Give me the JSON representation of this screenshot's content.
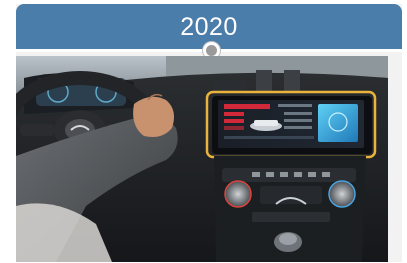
{
  "timeline": {
    "year": "2020"
  },
  "photo": {
    "highlight_color": "#e9b33c",
    "screen_accent": "#3fb6e8",
    "screen_alert": "#d2293a"
  }
}
